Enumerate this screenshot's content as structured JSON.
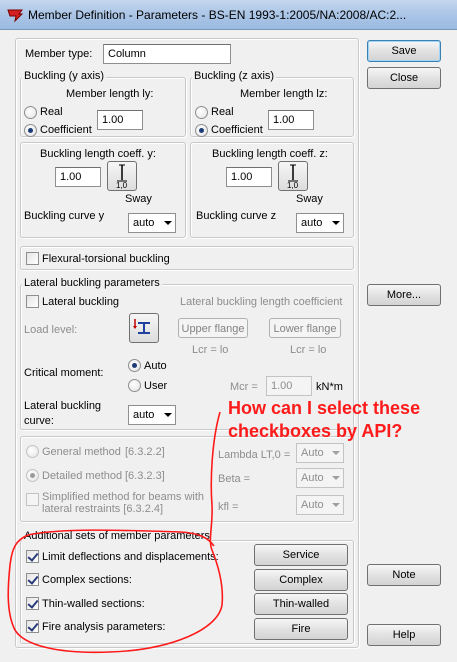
{
  "window": {
    "title": "Member Definition - Parameters - BS-EN 1993-1:2005/NA:2008/AC:2..."
  },
  "buttons": {
    "save": "Save",
    "close": "Close",
    "more": "More...",
    "note": "Note",
    "help": "Help"
  },
  "member_type": {
    "label": "Member type:",
    "value": "Column"
  },
  "buckling_y": {
    "title": "Buckling (y axis)",
    "member_length_label": "Member length ly:",
    "real_label": "Real",
    "coefficient_label": "Coefficient",
    "member_length_value": "1.00",
    "coeff_label": "Buckling length coeff. y:",
    "coeff_value": "1.00",
    "sway_icon_text": "1,0",
    "sway_label": "Sway",
    "curve_label": "Buckling curve y",
    "curve_value": "auto"
  },
  "buckling_z": {
    "title": "Buckling (z axis)",
    "member_length_label": "Member length lz:",
    "real_label": "Real",
    "coefficient_label": "Coefficient",
    "member_length_value": "1.00",
    "coeff_label": "Buckling length coeff. z:",
    "coeff_value": "1.00",
    "sway_icon_text": "1,0",
    "sway_label": "Sway",
    "curve_label": "Buckling curve z",
    "curve_value": "auto"
  },
  "flexural": {
    "label": "Flexural-torsional buckling"
  },
  "lateral": {
    "title": "Lateral buckling parameters",
    "checkbox_label": "Lateral buckling",
    "length_coeff_label": "Lateral buckling length coefficient",
    "load_level_label": "Load level:",
    "upper_flange": "Upper flange",
    "lower_flange": "Lower flange",
    "lcr_upper": "Lcr =  lo",
    "lcr_lower": "Lcr =  lo",
    "critical_moment_label": "Critical moment:",
    "auto_label": "Auto",
    "user_label": "User",
    "mcr_label": "Mcr =",
    "mcr_value": "1.00",
    "mcr_unit": "kN*m",
    "curve_label_line1": "Lateral buckling",
    "curve_label_line2": "curve:",
    "curve_value": "auto"
  },
  "methods": {
    "general": "General method",
    "general_ref": "[6.3.2.2]",
    "detailed": "Detailed method",
    "detailed_ref": "[6.3.2.3]",
    "simplified_line1": "Simplified method for beams with",
    "simplified_line2": "lateral restraints [6.3.2.4]",
    "lambda_label": "Lambda LT,0 =",
    "lambda_value": "Auto",
    "beta_label": "Beta =",
    "beta_value": "Auto",
    "kfl_label": "kfl =",
    "kfl_value": "Auto"
  },
  "additional": {
    "title": "Additional sets of member parameters",
    "limit_label": "Limit deflections and displacements:",
    "complex_label": "Complex sections:",
    "thin_label": "Thin-walled sections:",
    "fire_label": "Fire analysis parameters:",
    "service_btn": "Service",
    "complex_btn": "Complex",
    "thin_btn": "Thin-walled",
    "fire_btn": "Fire"
  },
  "annotation": {
    "line1": "How can I select these",
    "line2": "checkboxes by API?",
    "color": "#ff1a1a"
  }
}
